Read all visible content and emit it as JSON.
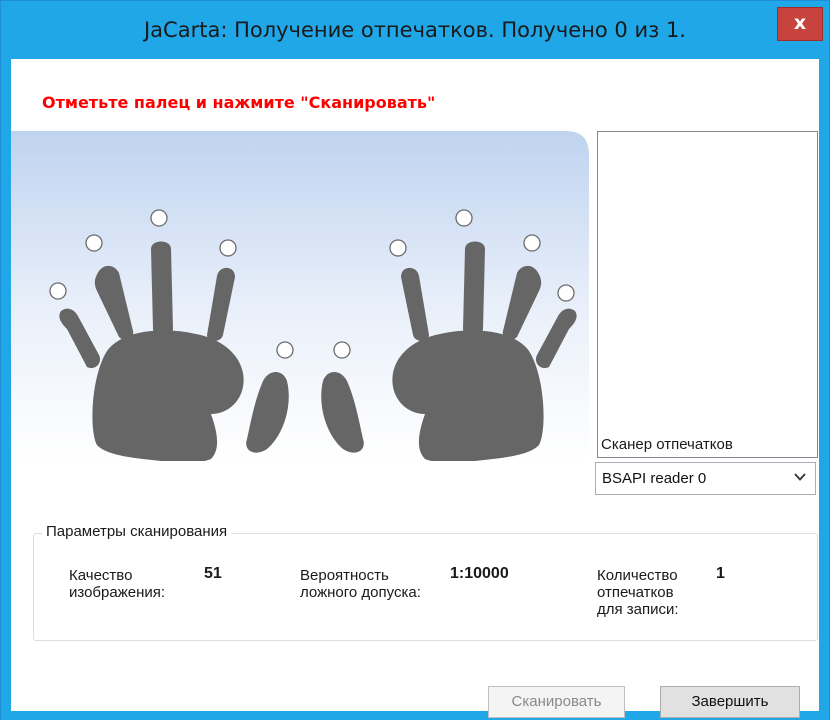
{
  "window": {
    "title": "JaCarta: Получение отпечатков. Получено 0 из 1.",
    "close_label": "x"
  },
  "instruction": "Отметьте палец и нажмите \"Сканировать\"",
  "hands": {
    "finger_markers": [
      "left-pinky",
      "left-ring",
      "left-middle",
      "left-index",
      "left-thumb",
      "right-thumb",
      "right-index",
      "right-middle",
      "right-ring",
      "right-pinky"
    ],
    "palm_color": "#666666",
    "background_gradient": [
      "#bfd3f0",
      "#ffffff"
    ]
  },
  "scanner": {
    "label": "Сканер отпечатков",
    "selected": "BSAPI reader 0"
  },
  "params": {
    "legend": "Параметры сканирования",
    "quality": {
      "label_line1": "Качество",
      "label_line2": "изображения:",
      "value": "51"
    },
    "far": {
      "label_line1": "Вероятность",
      "label_line2": "ложного допуска:",
      "value": "1:10000"
    },
    "count": {
      "label_line1": "Количество",
      "label_line2": "отпечатков",
      "label_line3": "для записи:",
      "value": "1"
    }
  },
  "buttons": {
    "scan": "Сканировать",
    "finish": "Завершить"
  },
  "colors": {
    "titlebar": "#1fa7e8",
    "close": "#c7433d",
    "instruction": "#ff0000"
  }
}
